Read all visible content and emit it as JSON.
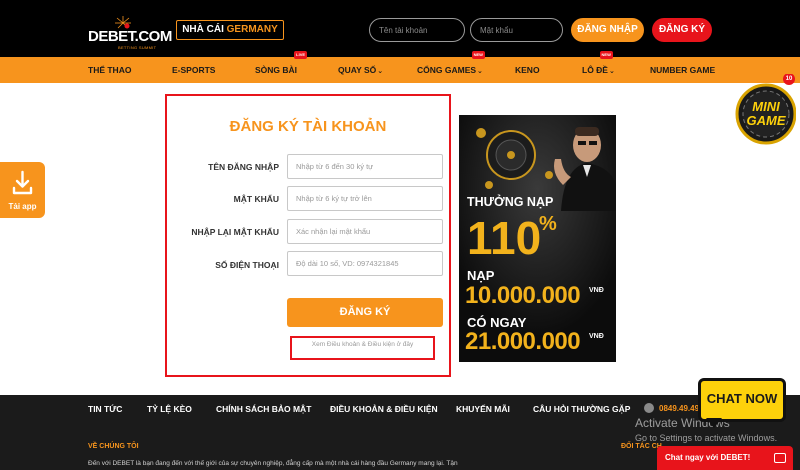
{
  "header": {
    "logo_text": "DEBET.COM",
    "logo_sub": "BETTING SUMMIT",
    "badge_prefix": "NHÀ CÁI",
    "badge_highlight": "GERMANY",
    "username_placeholder": "Tên tài khoản",
    "password_placeholder": "Mật khẩu",
    "login_label": "ĐĂNG NHẬP",
    "register_label": "ĐĂNG KÝ"
  },
  "nav": {
    "items": [
      {
        "label": "THỂ THAO"
      },
      {
        "label": "E-SPORTS"
      },
      {
        "label": "SÒNG BÀI",
        "badge": "LIVE"
      },
      {
        "label": "QUAY SỐ"
      },
      {
        "label": "CỔNG GAMES",
        "badge": "NEW"
      },
      {
        "label": "KENO"
      },
      {
        "label": "LÔ ĐỀ",
        "badge": "NEW"
      },
      {
        "label": "NUMBER GAME"
      }
    ]
  },
  "minigame": {
    "line1": "MINI",
    "line2": "GAME",
    "count": "10"
  },
  "side_app": {
    "label": "Tải app"
  },
  "form": {
    "title": "ĐĂNG KÝ TÀI KHOẢN",
    "fields": [
      {
        "label": "TÊN ĐĂNG NHẬP",
        "placeholder": "Nhập từ 6 đến 30 ký tự"
      },
      {
        "label": "MẬT KHẨU",
        "placeholder": "Nhập từ 6 ký tự trở lên"
      },
      {
        "label": "NHẬP LẠI MẬT KHẨU",
        "placeholder": "Xác nhận lại mật khẩu"
      },
      {
        "label": "SỐ ĐIỆN THOẠI",
        "placeholder": "Độ dài 10 số, VD: 0974321845"
      }
    ],
    "submit_label": "ĐĂNG KÝ",
    "terms_link": "Xem Điều khoản & Điều kiện ở đây"
  },
  "promo": {
    "line1": "THƯỞNG NẠP",
    "percent": "110",
    "percent_sign": "%",
    "nap": "NẠP",
    "amount1": "10.000.000",
    "co_ngay": "CÓ NGAY",
    "amount2": "21.000.000",
    "currency": "VNĐ"
  },
  "footer": {
    "links": [
      {
        "label": "TIN TỨC"
      },
      {
        "label": "TỶ LỆ KÈO"
      },
      {
        "label": "CHÍNH SÁCH BẢO MẬT"
      },
      {
        "label": "ĐIỀU KHOẢN & ĐIỀU KIỆN"
      },
      {
        "label": "KHUYẾN MÃI"
      },
      {
        "label": "CÂU HỎI THƯỜNG GẶP"
      }
    ],
    "phone": "0849.49.49",
    "about_title": "VỀ CHÚNG TÔI",
    "about_text": "Đến với DEBET là bạn đang đến với thế giới của sự chuyên nghiệp, đẳng cấp mà một nhà cái hàng đầu Germany mang lại. Tận",
    "partner_title": "ĐỐI TÁC CH"
  },
  "watermark": {
    "line1": "Activate Windows",
    "line2": "Go to Settings to activate Windows."
  },
  "chat": {
    "bubble": "CHAT NOW",
    "bar": "Chat ngay với DEBET!"
  },
  "colors": {
    "accent": "#f7941d",
    "danger": "#e8141b",
    "dark": "#000000",
    "chat_yellow": "#fdd10b"
  }
}
